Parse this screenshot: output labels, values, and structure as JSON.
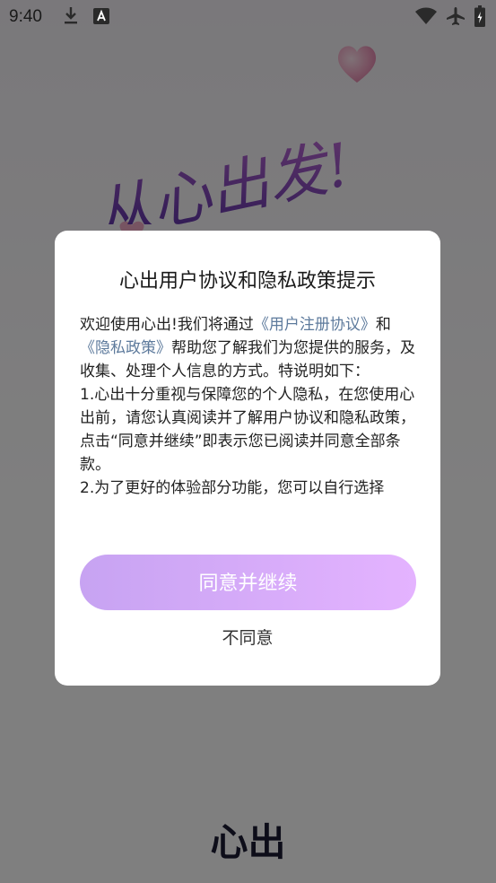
{
  "status_bar": {
    "time": "9:40",
    "icons": [
      "download-icon",
      "a-icon",
      "wifi-icon",
      "airplane-icon",
      "battery-icon"
    ]
  },
  "splash": {
    "title_art": "从心出发!",
    "brand": "心出"
  },
  "dialog": {
    "title": "心出用户协议和隐私政策提示",
    "intro_before": "欢迎使用心出!我们将通过",
    "link_terms": "《用户注册协议》",
    "and": "和",
    "link_privacy": "《隐私政策》",
    "intro_after": "帮助您了解我们为您提供的服务，及收集、处理个人信息的方式。特说明如下：",
    "point1": "1.心出十分重视与保障您的个人隐私，在您使用心出前，请您认真阅读并了解用户协议和隐私政策，点击“同意并继续”即表示您已阅读并同意全部条款。",
    "point2": "2.为了更好的体验部分功能，您可以自行选择",
    "agree_label": "同意并继续",
    "disagree_label": "不同意"
  },
  "colors": {
    "link": "#5d7a9c",
    "button_gradient_start": "#c7a3f2",
    "button_gradient_end": "#e4b3ff",
    "overlay": "rgba(0,0,0,0.5)"
  }
}
